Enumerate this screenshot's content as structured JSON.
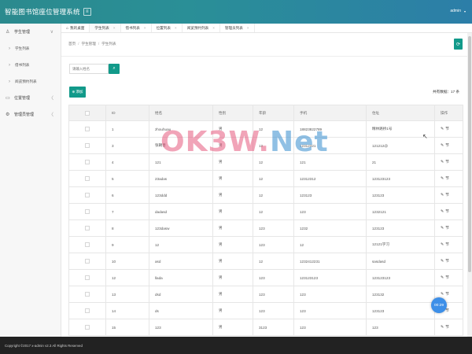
{
  "app": {
    "title": "智能图书馆座位管理系统",
    "menu_toggle_icon": "hamburger-icon",
    "user": "admin"
  },
  "sidebar": {
    "items": [
      {
        "label": "学生管理",
        "icon": "user-icon",
        "arrow": "∨"
      },
      {
        "label": "学生列表",
        "sub": true
      },
      {
        "label": "借书列表",
        "sub": true
      },
      {
        "label": "阅览预约列表",
        "sub": true
      },
      {
        "label": "位置管理",
        "icon": "seat-icon",
        "arrow": "〈"
      },
      {
        "label": "管理员管理",
        "icon": "admin-icon",
        "arrow": "〈"
      }
    ]
  },
  "tabs": [
    {
      "label": "我的桌面",
      "home": true
    },
    {
      "label": "学生列表"
    },
    {
      "label": "借书列表"
    },
    {
      "label": "位置列表"
    },
    {
      "label": "阅览预约列表"
    },
    {
      "label": "管理员列表"
    }
  ],
  "breadcrumb": {
    "items": [
      "首页",
      "学生管理",
      "学生列表"
    ],
    "separator": "/"
  },
  "search": {
    "placeholder": "请输入姓名",
    "value": ""
  },
  "toolbar": {
    "add_label": "添加",
    "total_label": "共有数据：17 条"
  },
  "table": {
    "headers": [
      "",
      "ID",
      "姓名",
      "性别",
      "年龄",
      "手机",
      "住址",
      "操作"
    ],
    "rows": [
      {
        "id": "1",
        "name": "zhouhuau",
        "gender": "男",
        "age": "12",
        "phone": "18823822789",
        "address": "精林路桥1号"
      },
      {
        "id": "3",
        "name": "张朝善",
        "gender": "男",
        "age": "12",
        "phone": "12312321",
        "address": "121212@"
      },
      {
        "id": "4",
        "name": "121",
        "gender": "男",
        "age": "12",
        "phone": "121",
        "address": "21"
      },
      {
        "id": "5",
        "name": "23adas",
        "gender": "男",
        "age": "12",
        "phone": "12312312",
        "address": "123123123"
      },
      {
        "id": "6",
        "name": "123ddd",
        "gender": "男",
        "age": "12",
        "phone": "123123",
        "address": "123123"
      },
      {
        "id": "7",
        "name": "dadasd",
        "gender": "男",
        "age": "12",
        "phone": "123",
        "address": "1232121"
      },
      {
        "id": "8",
        "name": "123dasw",
        "gender": "男",
        "age": "123",
        "phone": "1232",
        "address": "123123"
      },
      {
        "id": "9",
        "name": "12",
        "gender": "男",
        "age": "123",
        "phone": "12",
        "address": "12121学习"
      },
      {
        "id": "10",
        "name": "asd",
        "gender": "男",
        "age": "12",
        "phone": "1232412231",
        "address": "sasdasd"
      },
      {
        "id": "12",
        "name": "llada",
        "gender": "男",
        "age": "123",
        "phone": "123123123",
        "address": "123123123"
      },
      {
        "id": "13",
        "name": "dsd",
        "gender": "男",
        "age": "123",
        "phone": "123",
        "address": "123132"
      },
      {
        "id": "14",
        "name": "ds",
        "gender": "男",
        "age": "123",
        "phone": "123",
        "address": "123123"
      },
      {
        "id": "15",
        "name": "123",
        "gender": "男",
        "age": "3123",
        "phone": "123",
        "address": "123"
      }
    ],
    "edit_icon": "pencil-icon",
    "op_label": "节"
  },
  "footer": {
    "text": "Copyright ©2017 x-admin v2.3 All Rights Reserved"
  },
  "float_badge": {
    "label": "00:29"
  },
  "watermark": {
    "main": "OK3W.",
    "accent": "Net"
  },
  "colors": {
    "primary": "#129a8a",
    "header": "#2a8f97",
    "badge": "#3d8fe8"
  }
}
